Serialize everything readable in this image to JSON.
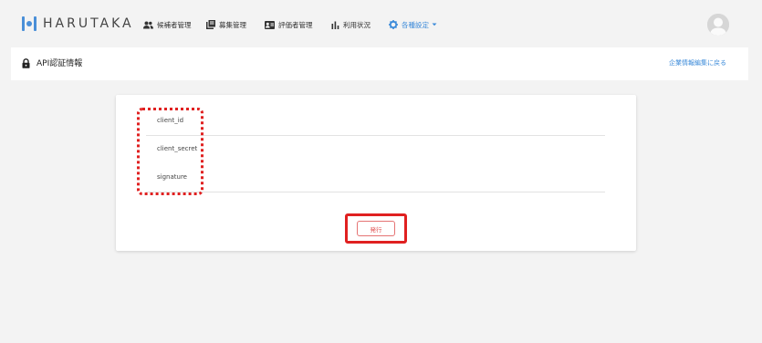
{
  "brand": {
    "name": "HARUTAKA"
  },
  "nav": {
    "items": [
      {
        "label": "候補者管理",
        "icon": "people-icon"
      },
      {
        "label": "募集管理",
        "icon": "library-books-icon"
      },
      {
        "label": "評価者管理",
        "icon": "contact-card-icon"
      },
      {
        "label": "利用状況",
        "icon": "bar-chart-icon"
      },
      {
        "label": "各種設定",
        "icon": "gear-icon",
        "active": true,
        "dropdown": true
      }
    ]
  },
  "header": {
    "title": "API認証情報",
    "back_link": "企業情報編集に戻る"
  },
  "fields": [
    {
      "label": "client_id",
      "value": ""
    },
    {
      "label": "client_secret",
      "value": ""
    },
    {
      "label": "signature",
      "value": ""
    }
  ],
  "actions": {
    "issue_label": "発行"
  },
  "colors": {
    "accent": "#3b8ad9",
    "highlight": "#e02020",
    "button_text": "#e05050"
  }
}
